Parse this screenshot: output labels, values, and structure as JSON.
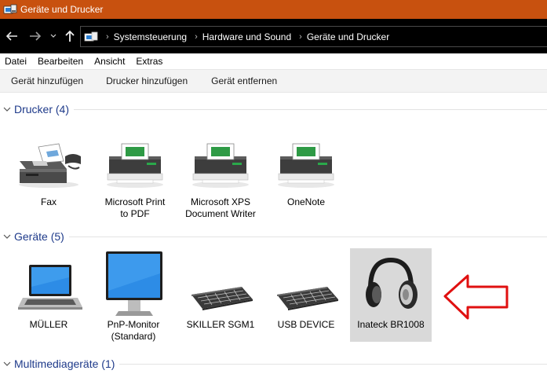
{
  "window": {
    "title": "Geräte und Drucker"
  },
  "address": {
    "crumbs": [
      "Systemsteuerung",
      "Hardware und Sound",
      "Geräte und Drucker"
    ]
  },
  "menu": [
    "Datei",
    "Bearbeiten",
    "Ansicht",
    "Extras"
  ],
  "commands": [
    "Gerät hinzufügen",
    "Drucker hinzufügen",
    "Gerät entfernen"
  ],
  "groups": {
    "printers": {
      "title": "Drucker (4)",
      "items": [
        {
          "label": "Fax",
          "icon": "fax-icon"
        },
        {
          "label": "Microsoft Print\nto PDF",
          "icon": "printer-icon"
        },
        {
          "label": "Microsoft XPS\nDocument Writer",
          "icon": "printer-icon"
        },
        {
          "label": "OneNote",
          "icon": "printer-icon"
        }
      ]
    },
    "devices": {
      "title": "Geräte (5)",
      "items": [
        {
          "label": "MÜLLER",
          "icon": "laptop-icon"
        },
        {
          "label": "PnP-Monitor\n(Standard)",
          "icon": "monitor-icon"
        },
        {
          "label": "SKILLER SGM1",
          "icon": "keyboard-icon"
        },
        {
          "label": "USB DEVICE",
          "icon": "keyboard-icon"
        },
        {
          "label": "Inateck BR1008",
          "icon": "headphones-icon",
          "selected": true
        }
      ]
    },
    "multimedia": {
      "title": "Multimediageräte (1)"
    }
  },
  "colors": {
    "titlebar": "#c8510f",
    "group_title": "#1e3a8a",
    "annotation_arrow": "#e01010",
    "selection": "#d9d9d9"
  }
}
